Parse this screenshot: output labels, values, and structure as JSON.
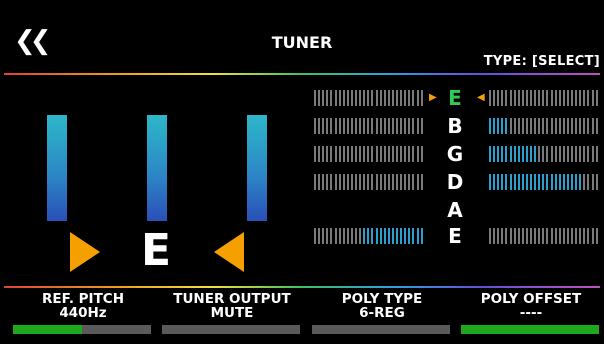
{
  "header": {
    "back_icon": "double-chevron-left-icon",
    "title": "TUNER",
    "type_label": "TYPE: [SELECT]"
  },
  "colors": {
    "green": "#1ea81e",
    "orange": "#f0a020",
    "meter_blue": "#2db7c9",
    "meter_segment": "#7a7a7a"
  },
  "main_display": {
    "note": "E",
    "flat_indicator_icon": "triangle-right-icon",
    "sharp_indicator_icon": "triangle-left-icon",
    "bars": [
      {
        "name": "left"
      },
      {
        "name": "center"
      },
      {
        "name": "right"
      }
    ]
  },
  "strings": [
    {
      "label": "E",
      "active": true,
      "left_level": 0.0,
      "right_level": 0.0
    },
    {
      "label": "B",
      "active": false,
      "left_level": 0.0,
      "right_level": 0.2
    },
    {
      "label": "G",
      "active": false,
      "left_level": 0.0,
      "right_level": 0.45
    },
    {
      "label": "D",
      "active": false,
      "left_level": 0.0,
      "right_level": 0.85
    },
    {
      "label": "A",
      "active": false,
      "left_level": null,
      "right_level": null
    },
    {
      "label": "E",
      "active": false,
      "left_level": 0.55,
      "right_level": 0.0
    }
  ],
  "params": [
    {
      "label": "REF. PITCH",
      "value": "440Hz",
      "level": 0.5
    },
    {
      "label": "TUNER OUTPUT",
      "value": "MUTE",
      "level": 0.0
    },
    {
      "label": "POLY TYPE",
      "value": "6-REG",
      "level": 0.0
    },
    {
      "label": "POLY OFFSET",
      "value": "----",
      "level": 1.0
    }
  ]
}
